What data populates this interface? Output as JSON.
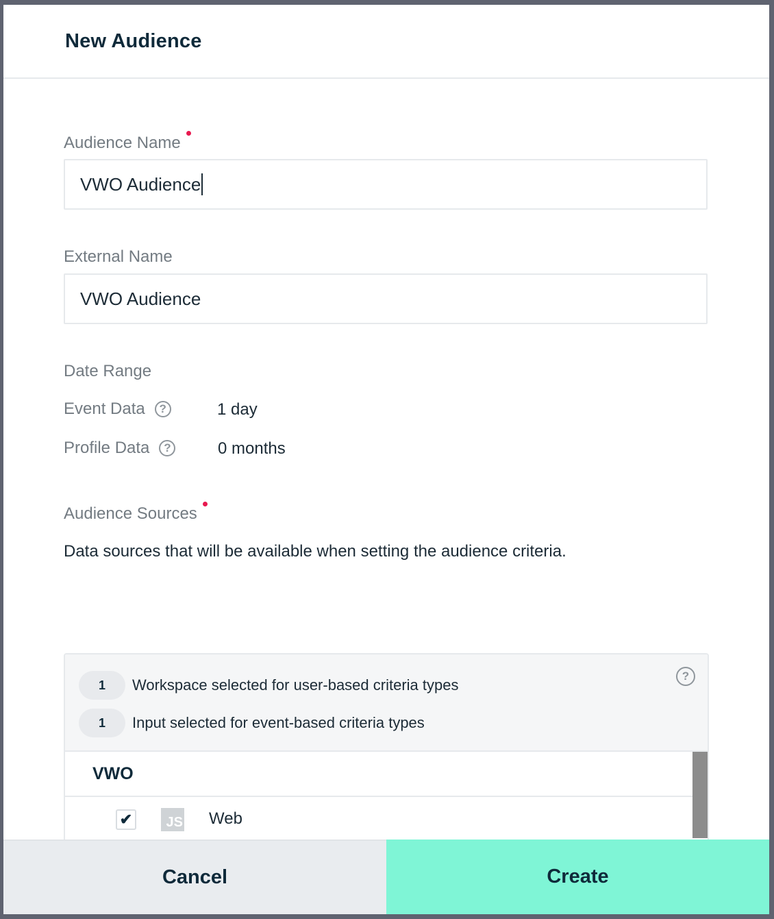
{
  "modal": {
    "title": "New Audience",
    "audience_name": {
      "label": "Audience Name",
      "value": "VWO Audience"
    },
    "external_name": {
      "label": "External Name",
      "value": "VWO Audience"
    },
    "date_range": {
      "label": "Date Range",
      "event_data": {
        "label": "Event Data",
        "value": "1 day"
      },
      "profile_data": {
        "label": "Profile Data",
        "value": "0 months"
      }
    },
    "audience_sources": {
      "label": "Audience Sources",
      "description": "Data sources that will be available when setting the audience criteria.",
      "summary": [
        {
          "count": "1",
          "text": "Workspace selected for user-based criteria types"
        },
        {
          "count": "1",
          "text": "Input selected for event-based criteria types"
        }
      ],
      "group": "VWO",
      "items": [
        {
          "icon_text": "JS",
          "label": "Web",
          "checked": true,
          "check_glyph": "✔"
        }
      ]
    },
    "help_glyph": "?",
    "buttons": {
      "cancel": "Cancel",
      "create": "Create"
    }
  }
}
